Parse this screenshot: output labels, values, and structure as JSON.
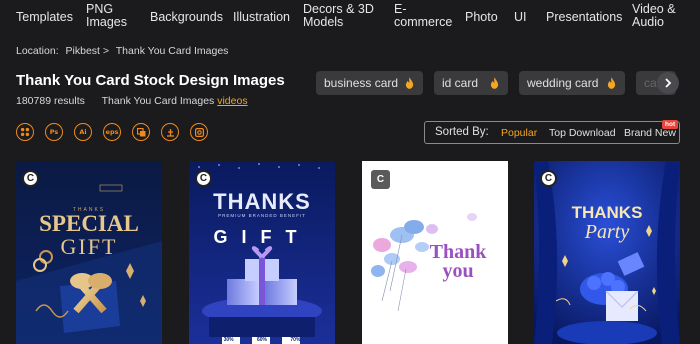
{
  "nav": [
    "Templates",
    "PNG\nImages",
    "Backgrounds",
    "Illustration",
    "Decors & 3D\nModels",
    "E-\ncommerce",
    "Photo",
    "UI",
    "Presentations",
    "Video &\nAudio"
  ],
  "breadcrumb": {
    "label": "Location:",
    "home": "Pikbest >",
    "current": "Thank You Card Images"
  },
  "page": {
    "title": "Thank You Card Stock Design Images",
    "result_count": "180789",
    "results_label": "results",
    "sub_label": "Thank You Card Images",
    "videos_link": "videos"
  },
  "tags": [
    "business card",
    "id card",
    "wedding card",
    "ca"
  ],
  "formats": [
    "all",
    "Ps",
    "Ai",
    "eps",
    "layers",
    "chart",
    "picture"
  ],
  "sort": {
    "label": "Sorted By:",
    "options": [
      "Popular",
      "Top Download",
      "Brand New"
    ],
    "active": "Popular",
    "badge": "hot"
  },
  "cards": [
    {
      "banner": "THANKS",
      "title1": "SPECIAL",
      "title2": "GIFT"
    },
    {
      "title1": "THANKS",
      "subtitle": "PREMIUM BRANDED BENEFIT",
      "title2": "GIFT",
      "price1": "30%",
      "price2": "60%",
      "price3": "70%"
    },
    {
      "title1": "Thank",
      "title2": "you"
    },
    {
      "title1": "THANKS",
      "title2": "Party"
    }
  ],
  "colors": {
    "accent": "#f5a623",
    "icon_orange": "#f08a1c",
    "hot": "#e8453c",
    "background": "#1b1b1d"
  }
}
